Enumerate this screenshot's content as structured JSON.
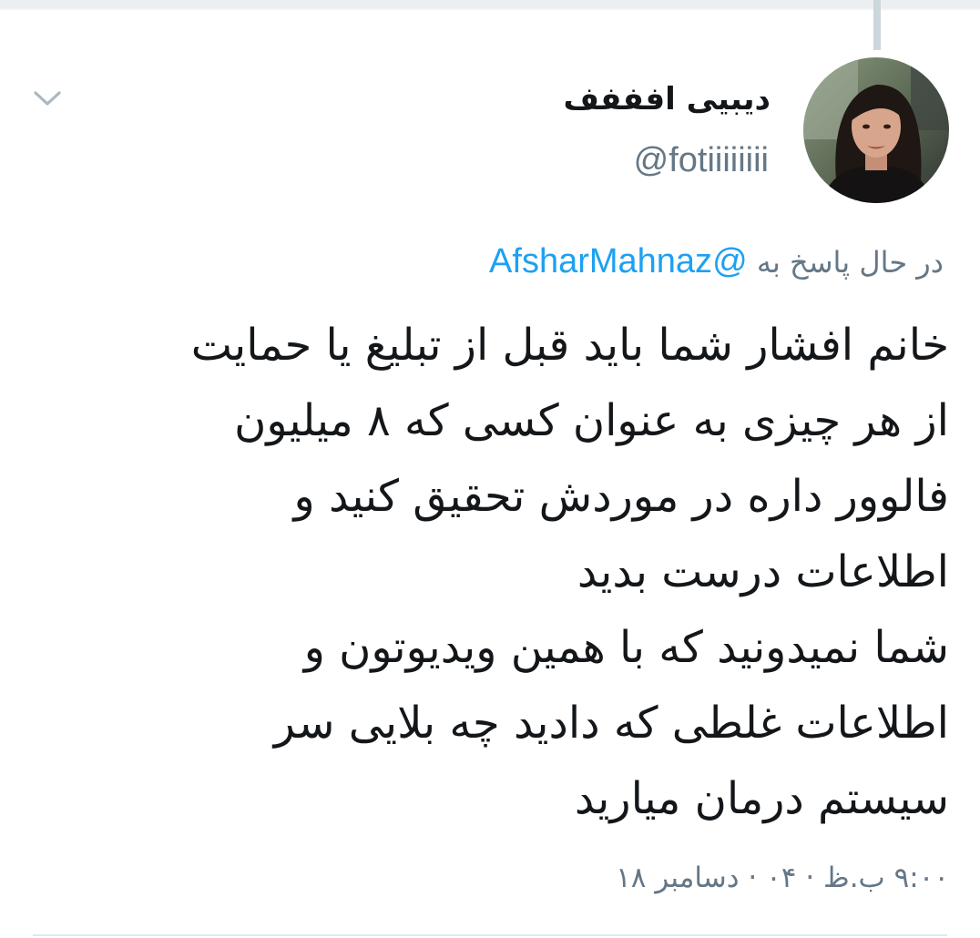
{
  "tweet": {
    "author": {
      "display_name": "دیبیی افففف",
      "handle": "@fotiiiiiiii",
      "avatar_icon": "profile-photo"
    },
    "reply": {
      "prefix": "در حال پاسخ به",
      "mention": "@AfsharMahnaz"
    },
    "text_lines": [
      "خانم افشار شما باید قبل از تبلیغ یا حمایت",
      "از هر چیزی به عنوان کسی که ۸ میلیون",
      "فالوور داره در موردش تحقیق کنید و",
      "اطلاعات درست بدید",
      "شما نمیدونید که با همین ویدیوتون و",
      "اطلاعات غلطی که دادید چه بلایی سر",
      "سیستم درمان میارید"
    ],
    "timestamp": "۹:۰۰ ب.ظ · ۰۴ · دسامبر ۱۸"
  },
  "icons": {
    "menu": "chevron-down-icon"
  },
  "colors": {
    "link": "#1da1f2",
    "secondary_text": "#657786",
    "primary_text": "#14171a",
    "thread_line": "#ccd6dd"
  }
}
